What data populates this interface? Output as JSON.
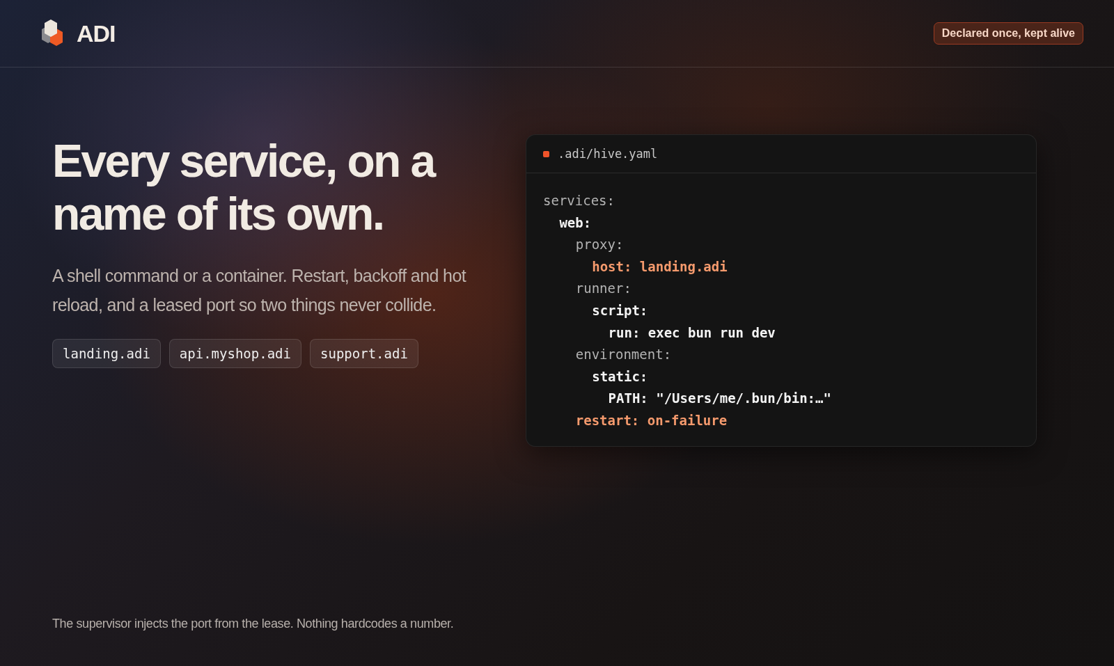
{
  "header": {
    "brand": "ADI",
    "badge": "Declared once, kept alive"
  },
  "hero": {
    "title": "Every service, on a name of its own.",
    "subtitle": "A shell command or a container. Restart, backoff and hot reload, and a leased port so two things never collide.",
    "domains": [
      "landing.adi",
      "api.myshop.adi",
      "support.adi"
    ]
  },
  "code_panel": {
    "filename": ".adi/hive.yaml",
    "lines": [
      {
        "text": "services:",
        "kind": "section",
        "children": [
          {
            "text": "web:",
            "kind": "key",
            "children": [
              {
                "text": "proxy:",
                "kind": "section",
                "children": [
                  {
                    "text": "host: landing.adi",
                    "kind": "highlight"
                  }
                ]
              },
              {
                "text": "runner:",
                "kind": "section",
                "children": [
                  {
                    "text": "script:",
                    "kind": "key",
                    "children": [
                      {
                        "text": "run: exec bun run dev",
                        "kind": "key"
                      }
                    ]
                  }
                ]
              },
              {
                "text": "environment:",
                "kind": "section",
                "children": [
                  {
                    "text": "static:",
                    "kind": "key",
                    "children": [
                      {
                        "text": "PATH: \"/Users/me/.bun/bin:…\"",
                        "kind": "key"
                      }
                    ]
                  }
                ]
              },
              {
                "text": "restart: on-failure",
                "kind": "highlight"
              }
            ]
          }
        ]
      }
    ]
  },
  "footer": {
    "note": "The supervisor injects the port from the lease. Nothing hardcodes a number."
  }
}
